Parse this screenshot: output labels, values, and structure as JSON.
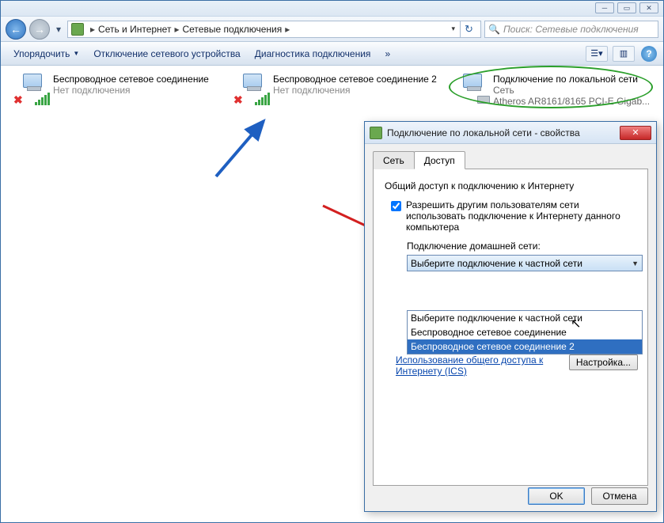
{
  "window": {
    "nav": {
      "crumb1": "Сеть и Интернет",
      "crumb2": "Сетевые подключения"
    },
    "search_placeholder": "Поиск: Сетевые подключения"
  },
  "toolbar": {
    "organize": "Упорядочить",
    "disable": "Отключение сетевого устройства",
    "diagnose": "Диагностика подключения",
    "more": "»"
  },
  "connections": [
    {
      "name": "Беспроводное сетевое соединение",
      "status": "Нет подключения"
    },
    {
      "name": "Беспроводное сетевое соединение 2",
      "status": "Нет подключения"
    },
    {
      "name": "Подключение по локальной сети",
      "status": "Сеть",
      "device": "Atheros AR8161/8165 PCI-E Gigab..."
    }
  ],
  "dialog": {
    "title": "Подключение по локальной сети - свойства",
    "tabs": {
      "network": "Сеть",
      "sharing": "Доступ"
    },
    "group": "Общий доступ к подключению к Интернету",
    "checkbox1": "Разрешить другим пользователям сети использовать подключение к Интернету данного компьютера",
    "homenet_label": "Подключение домашней сети:",
    "combo_value": "Выберите подключение к частной сети",
    "dropdown": {
      "opt1": "Выберите подключение к частной сети",
      "opt2": "Беспроводное сетевое соединение",
      "opt3": "Беспроводное сетевое соединение 2"
    },
    "link": "Использование общего доступа к Интернету (ICS)",
    "settings_btn": "Настройка...",
    "ok": "OK",
    "cancel": "Отмена"
  }
}
